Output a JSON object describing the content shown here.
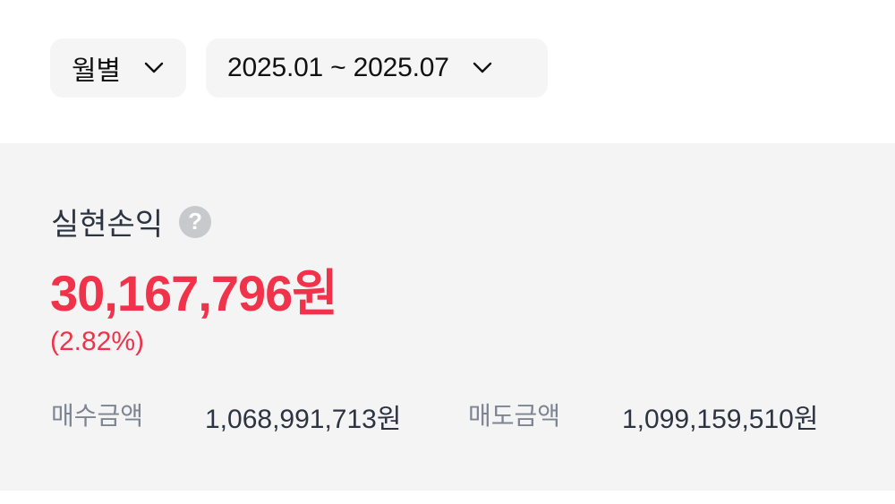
{
  "filters": {
    "period": "월별",
    "range": "2025.01 ~ 2025.07"
  },
  "summary": {
    "title": "실현손익",
    "help": "?",
    "profit": "30,167,796원",
    "rate": "(2.82%)",
    "buy_label": "매수금액",
    "buy_value": "1,068,991,713원",
    "sell_label": "매도금액",
    "sell_value": "1,099,159,510원"
  },
  "colors": {
    "profit": "#f0334a",
    "summary_bg": "#f4f4f5",
    "pill_bg": "#f5f5f6"
  },
  "icons": {
    "dropdown": "chevron-down-icon",
    "help": "question-circle-icon"
  }
}
